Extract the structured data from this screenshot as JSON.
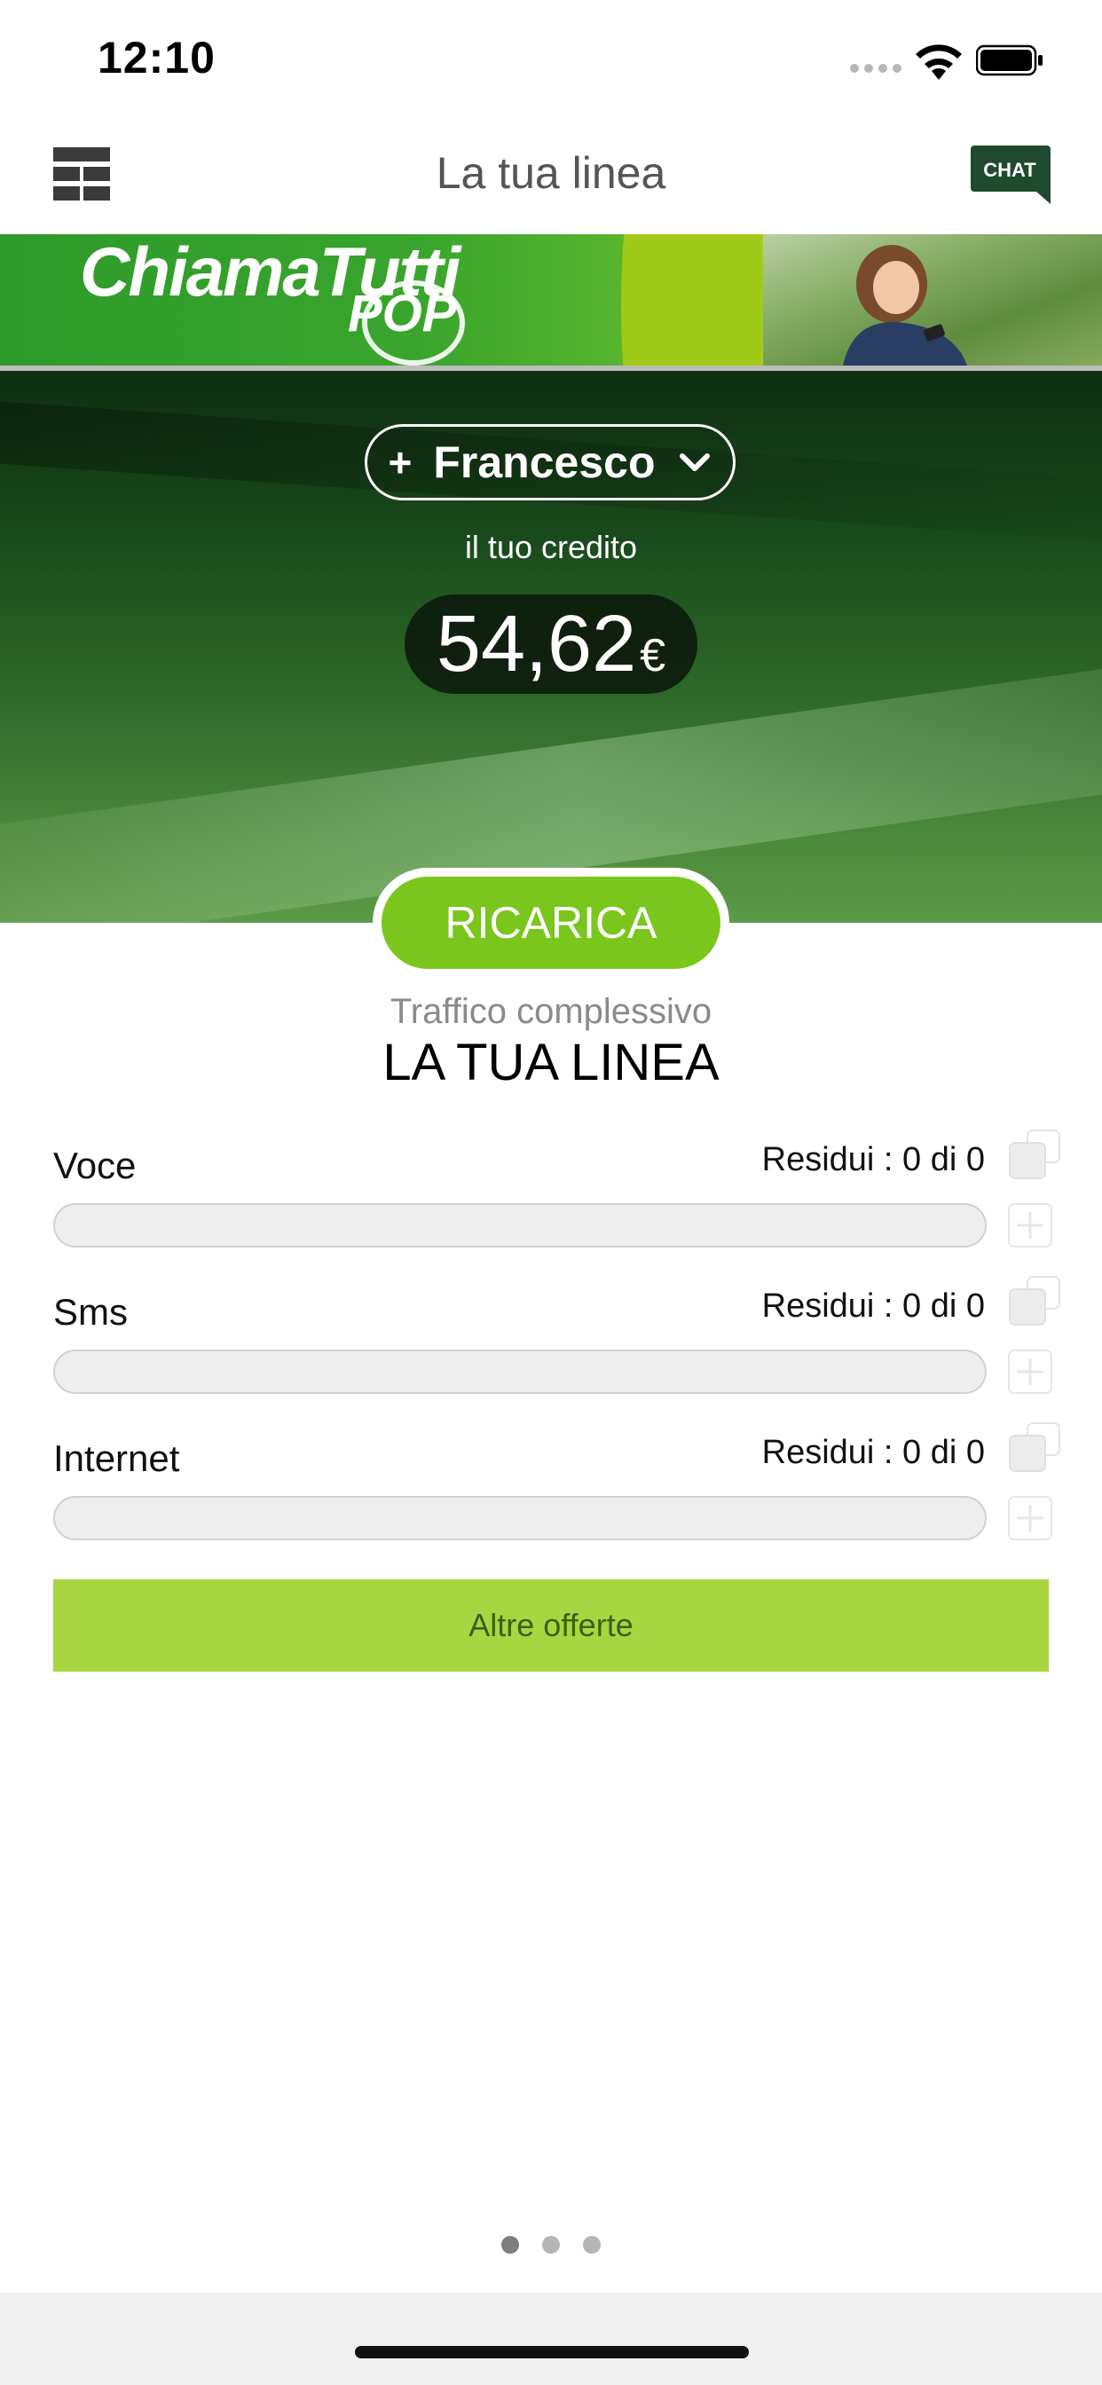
{
  "status_bar": {
    "time": "12:10"
  },
  "nav": {
    "title": "La tua linea",
    "chat_label": "CHAT"
  },
  "banner": {
    "logo_text": "ChiamaTutti",
    "logo_sub": "POP"
  },
  "account": {
    "plus": "+",
    "name": "Francesco",
    "credit_label": "il tuo credito",
    "credit_amount": "54,62",
    "currency": "€"
  },
  "ricarica_label": "RICARICA",
  "traffic": {
    "subtitle": "Traffico complessivo",
    "title": "LA TUA LINEA"
  },
  "usage": [
    {
      "label": "Voce",
      "residual": "Residui : 0 di 0",
      "fraction": 0
    },
    {
      "label": "Sms",
      "residual": "Residui : 0 di 0",
      "fraction": 0
    },
    {
      "label": "Internet",
      "residual": "Residui : 0 di 0",
      "fraction": 0
    }
  ],
  "altre_offerte": "Altre offerte",
  "pager": {
    "pages": 3,
    "current": 1
  },
  "colors": {
    "accent_green": "#7ac61d",
    "button_green": "#a7d641",
    "chat_bg": "#1f4a2e"
  }
}
